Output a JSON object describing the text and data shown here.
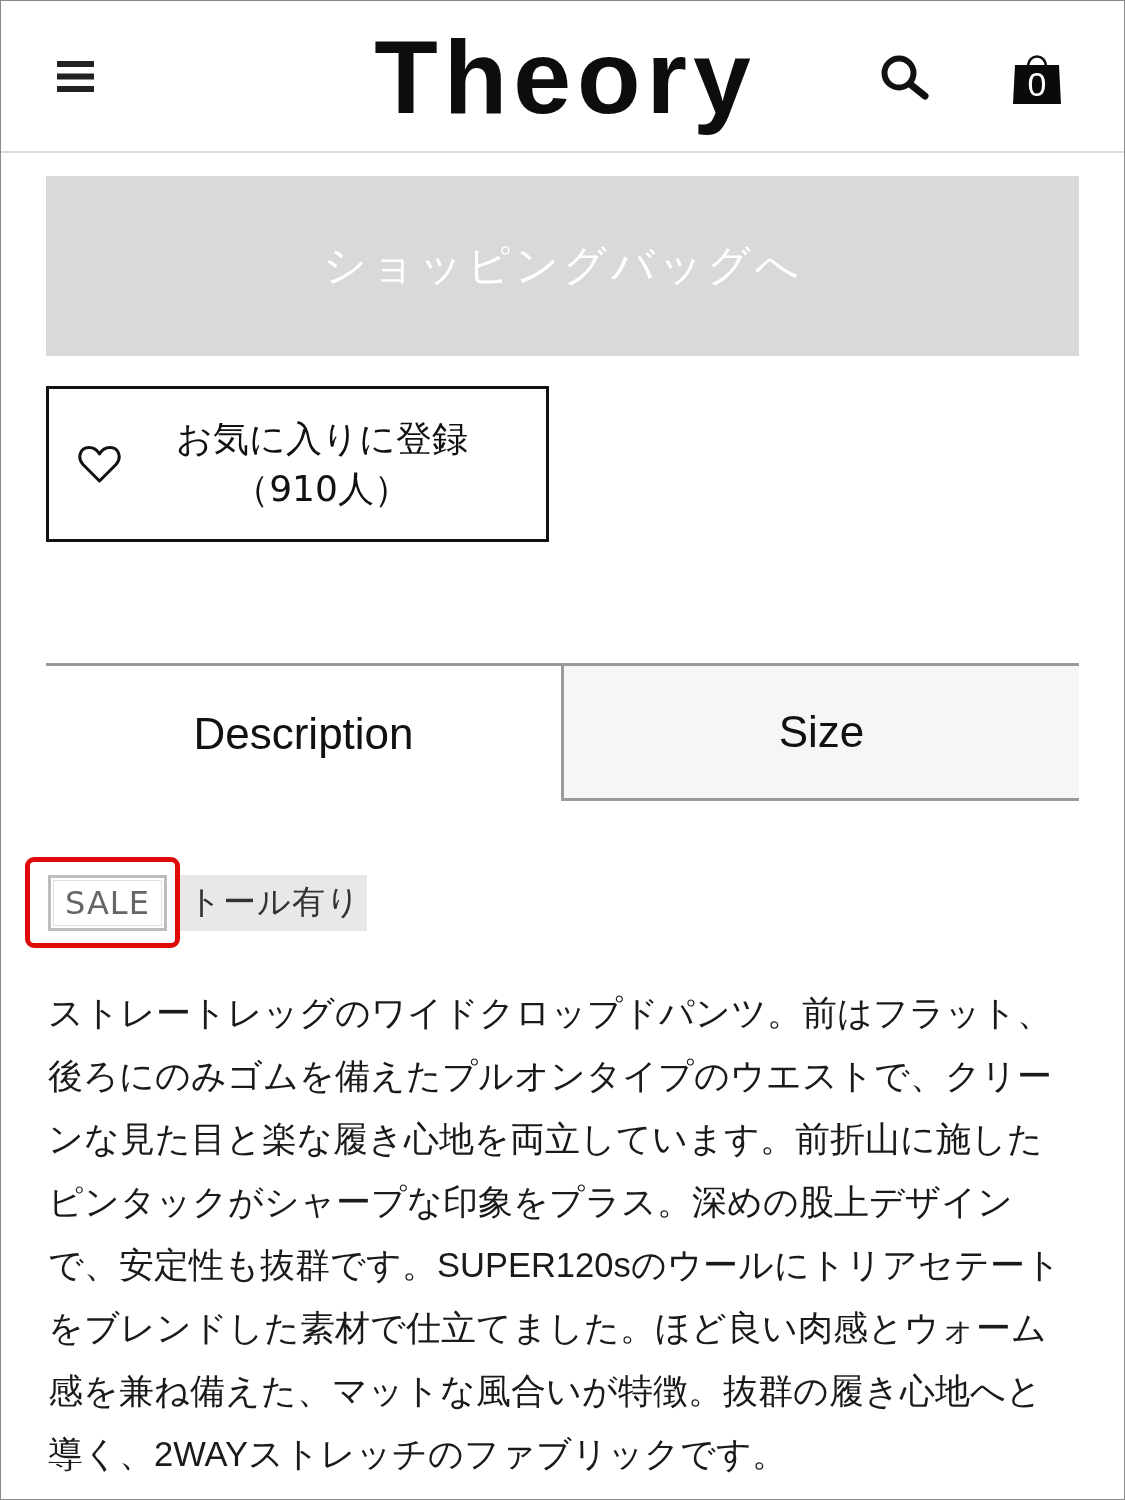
{
  "header": {
    "logo": "Theory",
    "cart_count": "0"
  },
  "bag_button": {
    "label": "ショッピングバッグへ",
    "disabled": true
  },
  "favorite_button": {
    "label": "お気に入りに登録",
    "count": "（910人）"
  },
  "tabs": [
    {
      "label": "Description",
      "selected": true
    },
    {
      "label": "Size",
      "selected": false
    }
  ],
  "tags": [
    {
      "label": "SALE",
      "kind": "outlined",
      "highlighted": true
    },
    {
      "label": "トール有り",
      "kind": "filled",
      "highlighted": false
    }
  ],
  "description": "ストレートレッグのワイドクロップドパンツ。前はフラット、後ろにのみゴムを備えたプルオンタイプのウエストで、クリーンな見た目と楽な履き心地を両立しています。前折山に施したピンタックがシャープな印象をプラス。深めの股上デザインで、安定性も抜群です。SUPER120sのウールにトリアセテートをブレンドした素材で仕立てました。ほど良い肉感とウォーム感を兼ね備えた、マットな風合いが特徴。抜群の履き心地へと導く、2WAYストレッチのファブリックです。"
}
